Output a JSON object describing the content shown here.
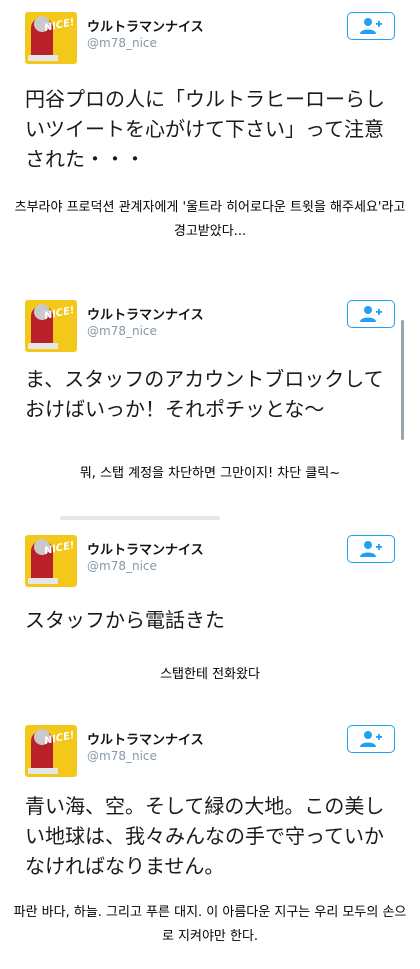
{
  "account": {
    "name": "ウルトラマンナイス",
    "handle": "@m78_nice",
    "avatar_badge": "NICE!"
  },
  "tweets": [
    {
      "text": "円谷プロの人に「ウルトラヒーローらしいツイートを心がけて下さい」って注意された・・・",
      "caption": "츠부라야 프로덕션 관계자에게 '울트라 히어로다운 트윗을 해주세요'라고 경고받았다..."
    },
    {
      "text": "ま、スタッフのアカウントブロックしておけばいっか！それポチッとな～",
      "caption": "뭐, 스탭 계정을 차단하면 그만이지! 차단 클릭~"
    },
    {
      "text": "スタッフから電話きた",
      "caption": "스탭한테 전화왔다"
    },
    {
      "text": "青い海、空。そして緑の大地。この美しい地球は、我々みんなの手で守っていかなければなりません。",
      "caption": "파란 바다, 하늘. 그리고 푸른 대지. 이 아름다운 지구는 우리 모두의 손으로 지켜야만 한다."
    }
  ],
  "icons": {
    "follow": "follow-user-icon"
  },
  "colors": {
    "accent": "#1da1f2",
    "handle": "#8899a6"
  }
}
